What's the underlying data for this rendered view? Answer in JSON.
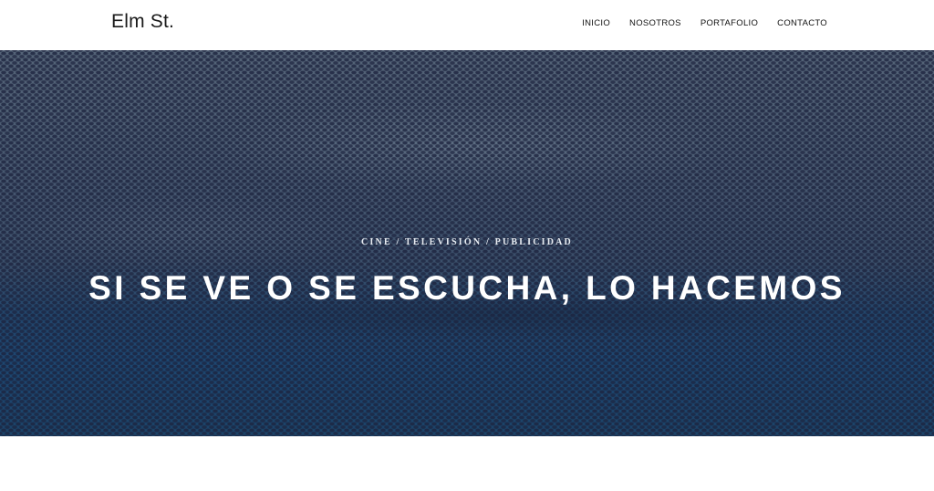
{
  "header": {
    "brand": "Elm St.",
    "nav": [
      "INICIO",
      "NOSOTROS",
      "PORTAFOLIO",
      "CONTACTO"
    ]
  },
  "hero": {
    "subtitle": "CINE / TELEVISIÓN / PUBLICIDAD",
    "headline": "SI SE VE O SE ESCUCHA, LO HACEMOS"
  },
  "colors": {
    "header_background": "#ffffff",
    "hero_background": "#3a4e69",
    "hero_text": "#ffffff"
  }
}
